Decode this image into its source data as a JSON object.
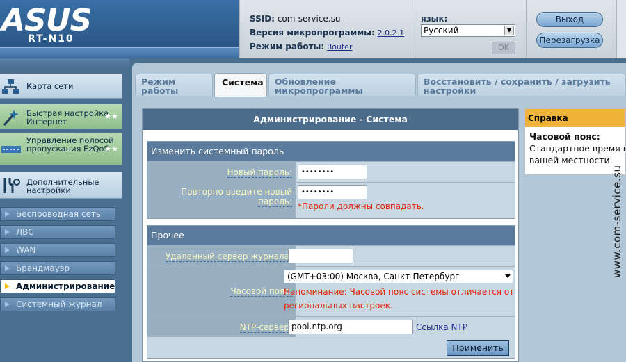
{
  "brand": {
    "logo": "ASUS",
    "model": "RT-N10"
  },
  "info": {
    "ssid_label": "SSID:",
    "ssid_value": "com-service.su",
    "firmware_label": "Версия микропрограммы:",
    "firmware_value": "2.0.2.1",
    "mode_label": "Режим работы:",
    "mode_value": "Router"
  },
  "language": {
    "label": "язык:",
    "selected": "Русский",
    "ok": "OK"
  },
  "header_buttons": {
    "logout": "Выход",
    "reboot": "Перезагрузка"
  },
  "sidebar": {
    "big_items": [
      {
        "label": "Карта сети",
        "icon": "network-map-icon"
      },
      {
        "label": "Быстрая настройка Интернет",
        "icon": "magic-wand-icon"
      },
      {
        "label": "Управление полосой пропускания EzQoS",
        "icon": "bandwidth-icon"
      },
      {
        "label": "Дополнительные настройки",
        "icon": "tools-icon"
      }
    ],
    "small_items": [
      {
        "label": "Беспроводная сеть"
      },
      {
        "label": "ЛВС"
      },
      {
        "label": "WAN"
      },
      {
        "label": "Брандмауэр"
      },
      {
        "label": "Администрирование",
        "active": true
      },
      {
        "label": "Системный журнал"
      }
    ]
  },
  "tabs": [
    {
      "label": "Режим работы"
    },
    {
      "label": "Система",
      "active": true
    },
    {
      "label": "Обновление микропрограммы"
    },
    {
      "label": "Восстановить / сохранить / загрузить настройки"
    }
  ],
  "content": {
    "title": "Администрирование - Система",
    "password_group": {
      "header": "Изменить системный пароль",
      "new_password_label": "Новый пароль:",
      "new_password_value": "••••••••",
      "confirm_label": "Повторно введите новый пароль:",
      "confirm_value": "••••••••",
      "note": "*Пароли должны совпадать."
    },
    "misc_group": {
      "header": "Прочее",
      "log_server_label": "Удаленный сервер журнала:",
      "log_server_value": "",
      "timezone_label": "Часовой пояс:",
      "timezone_value": "(GMT+03:00) Москва, Санкт-Петербург",
      "timezone_note_line1": "Напоминание: Часовой пояс системы отличается от",
      "timezone_note_line2": "региональных настроек.",
      "ntp_label": "NTP-сервер:",
      "ntp_value": "pool.ntp.org",
      "ntp_link": "Ссылка NTP"
    },
    "apply": "Применить"
  },
  "help": {
    "header": "Справка",
    "title": "Часовой пояс:",
    "line1": "Стандартное время в",
    "line2": "вашей местности."
  },
  "watermark": "www.com-service.su"
}
